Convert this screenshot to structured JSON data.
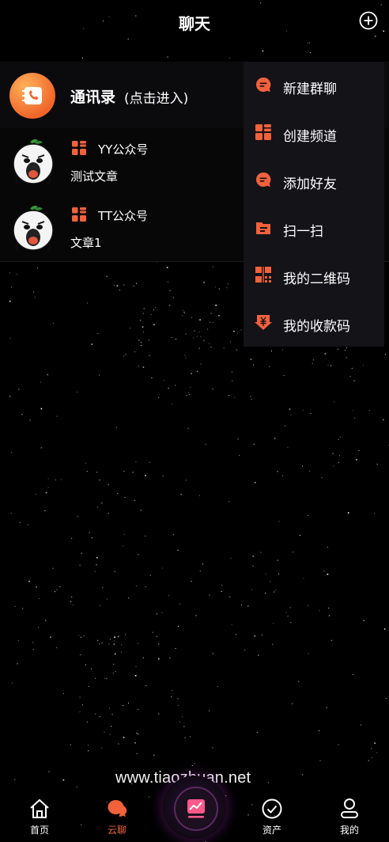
{
  "header": {
    "title": "聊天"
  },
  "contacts": {
    "label": "通讯录",
    "hint": "(点击进入)"
  },
  "chats": [
    {
      "name": "YY公众号",
      "preview": "测试文章"
    },
    {
      "name": "TT公众号",
      "preview": "文章1"
    }
  ],
  "menu": {
    "items": [
      {
        "label": "新建群聊",
        "icon": "chat-bubble-icon"
      },
      {
        "label": "创建频道",
        "icon": "grid-icon"
      },
      {
        "label": "添加好友",
        "icon": "chat-bubble-icon"
      },
      {
        "label": "扫一扫",
        "icon": "scan-icon"
      },
      {
        "label": "我的二维码",
        "icon": "qrcode-icon"
      },
      {
        "label": "我的收款码",
        "icon": "yuan-icon"
      }
    ]
  },
  "tabs": [
    {
      "label": "首页",
      "icon": "home-icon"
    },
    {
      "label": "云聊",
      "icon": "chat-icon",
      "active": true
    },
    {
      "label": "资产",
      "icon": "check-circle-icon"
    },
    {
      "label": "我的",
      "icon": "user-icon"
    }
  ],
  "watermark": "www.tiaozhuan.net",
  "colors": {
    "accent": "#f0613c",
    "menu_bg": "#131318",
    "background": "#000000"
  }
}
